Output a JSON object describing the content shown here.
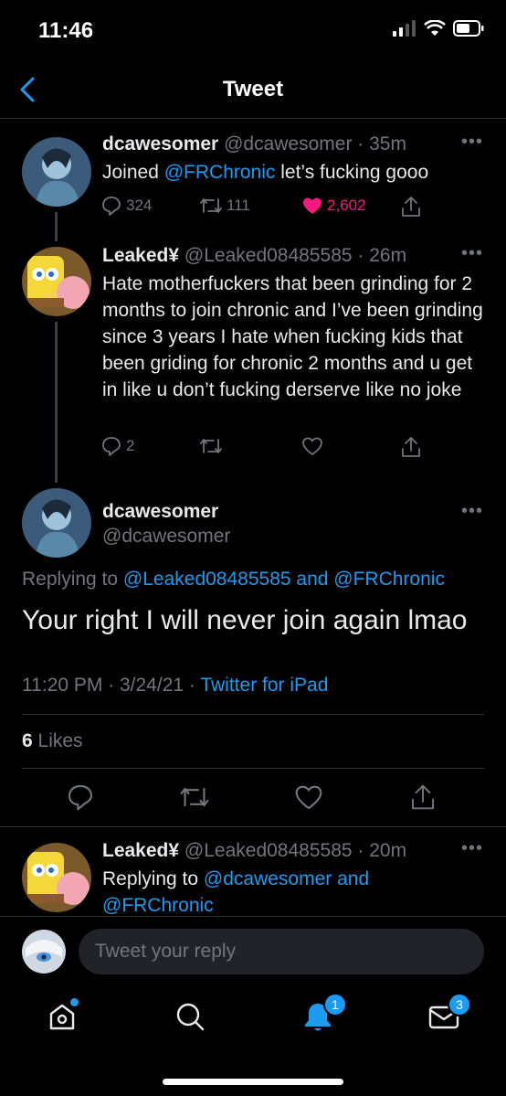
{
  "status": {
    "time": "11:46"
  },
  "nav": {
    "title": "Tweet"
  },
  "tweets": [
    {
      "name": "dcawesomer",
      "handle": "@dcawesomer",
      "time": "35m",
      "text_before": "Joined ",
      "mention": "@FRChronic",
      "text_after": " let’s fucking gooo",
      "replies": "324",
      "retweets": "111",
      "likes": "2,602"
    },
    {
      "name": "Leaked¥",
      "handle": "@Leaked08485585",
      "time": "26m",
      "text": "Hate motherfuckers that been grinding for 2 months to join chronic and I’ve been grinding since 3 years I hate when fucking kids that been griding for chronic 2 months and u get in like u don’t fucking derserve like no joke",
      "replies": "2"
    }
  ],
  "main": {
    "name": "dcawesomer",
    "handle": "@dcawesomer",
    "replying_prefix": "Replying to ",
    "replying_1": "@Leaked08485585",
    "replying_and": " and ",
    "replying_2": "@FRChronic",
    "text": "Your right I will never join again lmao",
    "timestamp": "11:20 PM · 3/24/21 · ",
    "source": "Twitter for iPad",
    "likes_count": "6",
    "likes_label": " Likes"
  },
  "reply": {
    "name": "Leaked¥",
    "handle": "@Leaked08485585",
    "time": "20m",
    "replying_prefix": "Replying to ",
    "replying_1": "@dcawesomer",
    "replying_and": " and",
    "replying_2": "@FRChronic"
  },
  "reply_bar": {
    "placeholder": "Tweet your reply"
  },
  "tabbar": {
    "notifications_badge": "1",
    "messages_badge": "3"
  },
  "colors": {
    "accent": "#1d9bf0",
    "like": "#f91880",
    "background": "#000000",
    "muted": "#71767b"
  },
  "icons": [
    "back-chevron-icon",
    "reply-icon",
    "retweet-icon",
    "like-icon",
    "share-icon",
    "more-icon",
    "home-icon",
    "search-icon",
    "bell-icon",
    "mail-icon"
  ]
}
